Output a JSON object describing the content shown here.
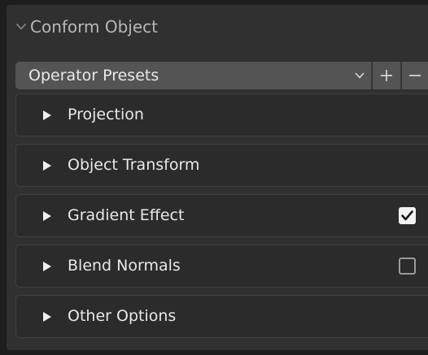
{
  "panel": {
    "title": "Conform Object",
    "expanded": true
  },
  "presets": {
    "label": "Operator Presets",
    "add_symbol": "+",
    "remove_symbol": "−"
  },
  "subpanels": [
    {
      "label": "Projection",
      "has_checkbox": false
    },
    {
      "label": "Object Transform",
      "has_checkbox": false
    },
    {
      "label": "Gradient Effect",
      "has_checkbox": true,
      "checked": true
    },
    {
      "label": "Blend Normals",
      "has_checkbox": true,
      "checked": false
    },
    {
      "label": "Other Options",
      "has_checkbox": false
    }
  ],
  "icons": {
    "panel_chevron": "chevron-down-icon",
    "dropdown": "chevron-down-icon",
    "subpanel_expand": "triangle-right-icon",
    "check": "checkmark-icon"
  },
  "colors": {
    "background": "#1d1d1d",
    "panel": "#303030",
    "subpanel": "#2b2b2b",
    "widget": "#545454",
    "text": "#e8e8e8",
    "header_text": "#b8b8b8"
  }
}
